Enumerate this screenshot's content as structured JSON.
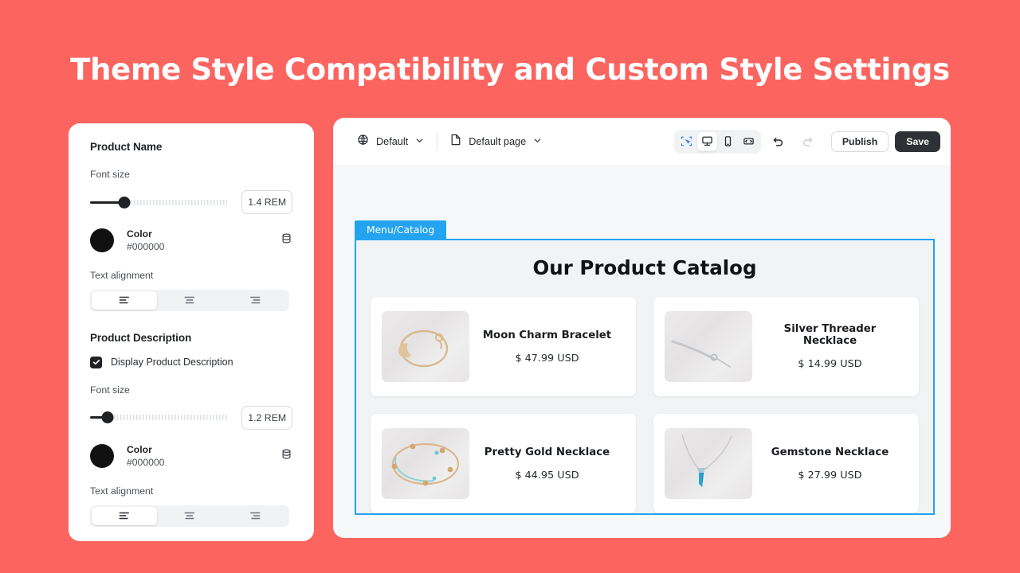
{
  "page": {
    "title": "Theme Style Compatibility and Custom Style Settings",
    "background_color": "#fc6460"
  },
  "settings_panel": {
    "groups": [
      {
        "title": "Product Name",
        "font_size_label": "Font size",
        "font_size_value": "1.4 REM",
        "slider_percent": 25,
        "color_label": "Color",
        "color_value": "#000000",
        "swatch_color": "#111111",
        "variable_icon": "database-icon",
        "alignment_label": "Text alignment",
        "alignment_options": [
          "align-left-icon",
          "align-center-icon",
          "align-right-icon"
        ],
        "alignment_selected": 0
      },
      {
        "title": "Product Description",
        "checkbox_label": "Display Product Description",
        "checkbox_checked": true,
        "font_size_label": "Font size",
        "font_size_value": "1.2 REM",
        "slider_percent": 13,
        "color_label": "Color",
        "color_value": "#000000",
        "swatch_color": "#111111",
        "variable_icon": "database-icon",
        "alignment_label": "Text alignment",
        "alignment_options": [
          "align-left-icon",
          "align-center-icon",
          "align-right-icon"
        ],
        "alignment_selected": 0
      }
    ]
  },
  "editor": {
    "toolbar": {
      "locale_icon": "globe-icon",
      "locale_label": "Default",
      "locale_chevron": "chevron-down-icon",
      "page_icon": "page-icon",
      "page_label": "Default page",
      "page_chevron": "chevron-down-icon",
      "device_buttons": [
        {
          "icon": "select-region-icon",
          "selected": false,
          "accent": "#2f87f5"
        },
        {
          "icon": "desktop-icon",
          "selected": true,
          "accent": "#25282c"
        },
        {
          "icon": "mobile-icon",
          "selected": false,
          "accent": "#25282c"
        },
        {
          "icon": "resize-horizontal-icon",
          "selected": false,
          "accent": "#25282c"
        }
      ],
      "undo_icon": "undo-icon",
      "redo_icon": "redo-icon",
      "undo_enabled": true,
      "redo_enabled": false,
      "publish_label": "Publish",
      "save_label": "Save",
      "save_bg": "#2e3135"
    },
    "canvas": {
      "section_tab_label": "Menu/Catalog",
      "section_accent": "#23a3f0",
      "catalog_title": "Our Product Catalog",
      "products": [
        {
          "name": "Moon Charm Bracelet",
          "price": "$ 47.99 USD",
          "image": "gold-bracelet-photo"
        },
        {
          "name": "Silver Threader Necklace",
          "price": "$ 14.99 USD",
          "image": "silver-necklace-photo"
        },
        {
          "name": "Pretty Gold Necklace",
          "price": "$ 44.95 USD",
          "image": "gold-beaded-necklace-photo"
        },
        {
          "name": "Gemstone Necklace",
          "price": "$ 27.99 USD",
          "image": "gemstone-pendant-photo"
        }
      ]
    }
  }
}
